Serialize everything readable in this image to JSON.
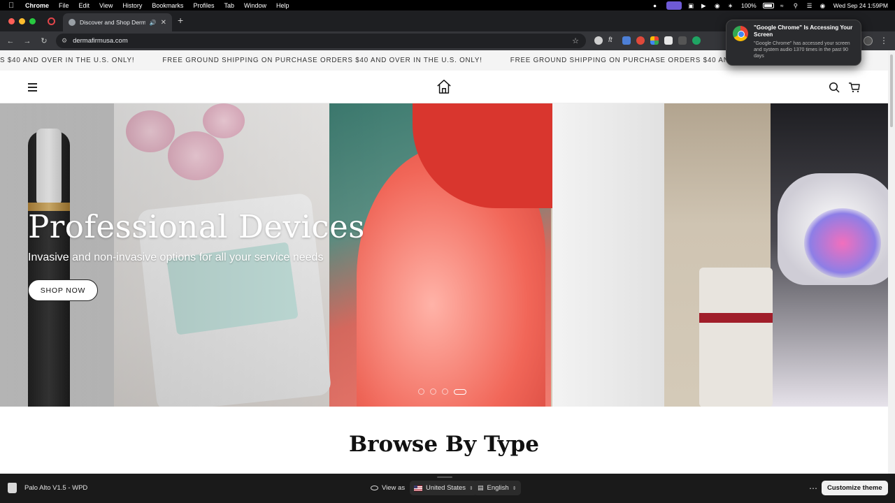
{
  "menubar": {
    "app_name": "Chrome",
    "items": [
      "File",
      "Edit",
      "View",
      "History",
      "Bookmarks",
      "Profiles",
      "Tab",
      "Window",
      "Help"
    ],
    "battery": "100%",
    "datetime": "Wed Sep 24  1:59PM"
  },
  "browser": {
    "tab_title": "Discover and Shop Derma",
    "url": "dermafirmusa.com"
  },
  "notification": {
    "title": "\"Google Chrome\" Is Accessing Your Screen",
    "body": "\"Google Chrome\" has accessed your screen and system audio 1370 times in the past 90 days"
  },
  "site": {
    "announcement": "FREE GROUND SHIPPING ON PURCHASE ORDERS $40 AND OVER IN THE U.S. ONLY!",
    "announcement_partial_left": "S $40 AND OVER IN THE U.S. ONLY!",
    "announcement_partial_right": "FREE GROUND SHIPPING ON PURCHASE ORDERS $40 AND OVER IN THE U.S. ONLY!",
    "hero": {
      "title": "Professional Devices",
      "subtitle": "Invasive and non-invasive options for all your service needs",
      "cta": "SHOP NOW",
      "slide_count": 4,
      "active_slide": 4
    },
    "section_title": "Browse By Type"
  },
  "themebar": {
    "theme_name": "Palo Alto V1.5 - WPD",
    "view_as_label": "View as",
    "country": "United States",
    "language": "English",
    "customize_label": "Customize theme"
  },
  "colors": {
    "accent_purple": "#6e5ad6",
    "tab_bg": "#35363a",
    "themebar_bg": "#1a1a1a"
  }
}
